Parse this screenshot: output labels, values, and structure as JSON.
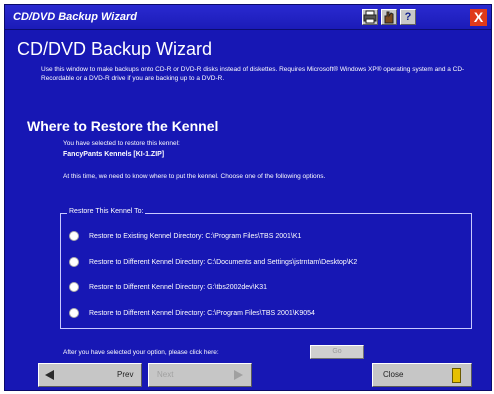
{
  "window": {
    "title": "CD/DVD Backup Wizard",
    "help_label": "?",
    "close_label": "X"
  },
  "header": {
    "title": "CD/DVD Backup Wizard",
    "intro": "Use this window to make backups onto CD-R or DVD-R disks instead of diskettes. Requires Microsoft® Windows XP® operating system and a CD-Recordable or a DVD-R drive if you are backing up to a DVD-R."
  },
  "restore": {
    "title": "Where to Restore the Kennel",
    "selected_line": "You have selected to restore this kennel:",
    "kennel_name": "FancyPants Kennels [KI-1.ZIP]",
    "instruction": "At this time, we need to know where to put the kennel. Choose one of the following options.",
    "group_label": "Restore This Kennel To:",
    "options": [
      "Restore to Existing Kennel Directory: C:\\Program Files\\TBS 2001\\K1",
      "Restore to Different Kennel Directory: C:\\Documents and Settings\\jstrntam\\Desktop\\K2",
      "Restore to Different Kennel Directory: G:\\tbs2002dev\\K31",
      "Restore to Different Kennel Directory: C:\\Program Files\\TBS 2001\\K9054"
    ]
  },
  "footer": {
    "after_text": "After you have selected your option, please click here:",
    "go_label": "Go",
    "prev_label": "Prev",
    "next_label": "Next",
    "close_label": "Close"
  },
  "colors": {
    "background": "#1717b4",
    "text": "#ffffff",
    "button_face": "#c6c6c6",
    "close_x": "#e03a1a"
  }
}
